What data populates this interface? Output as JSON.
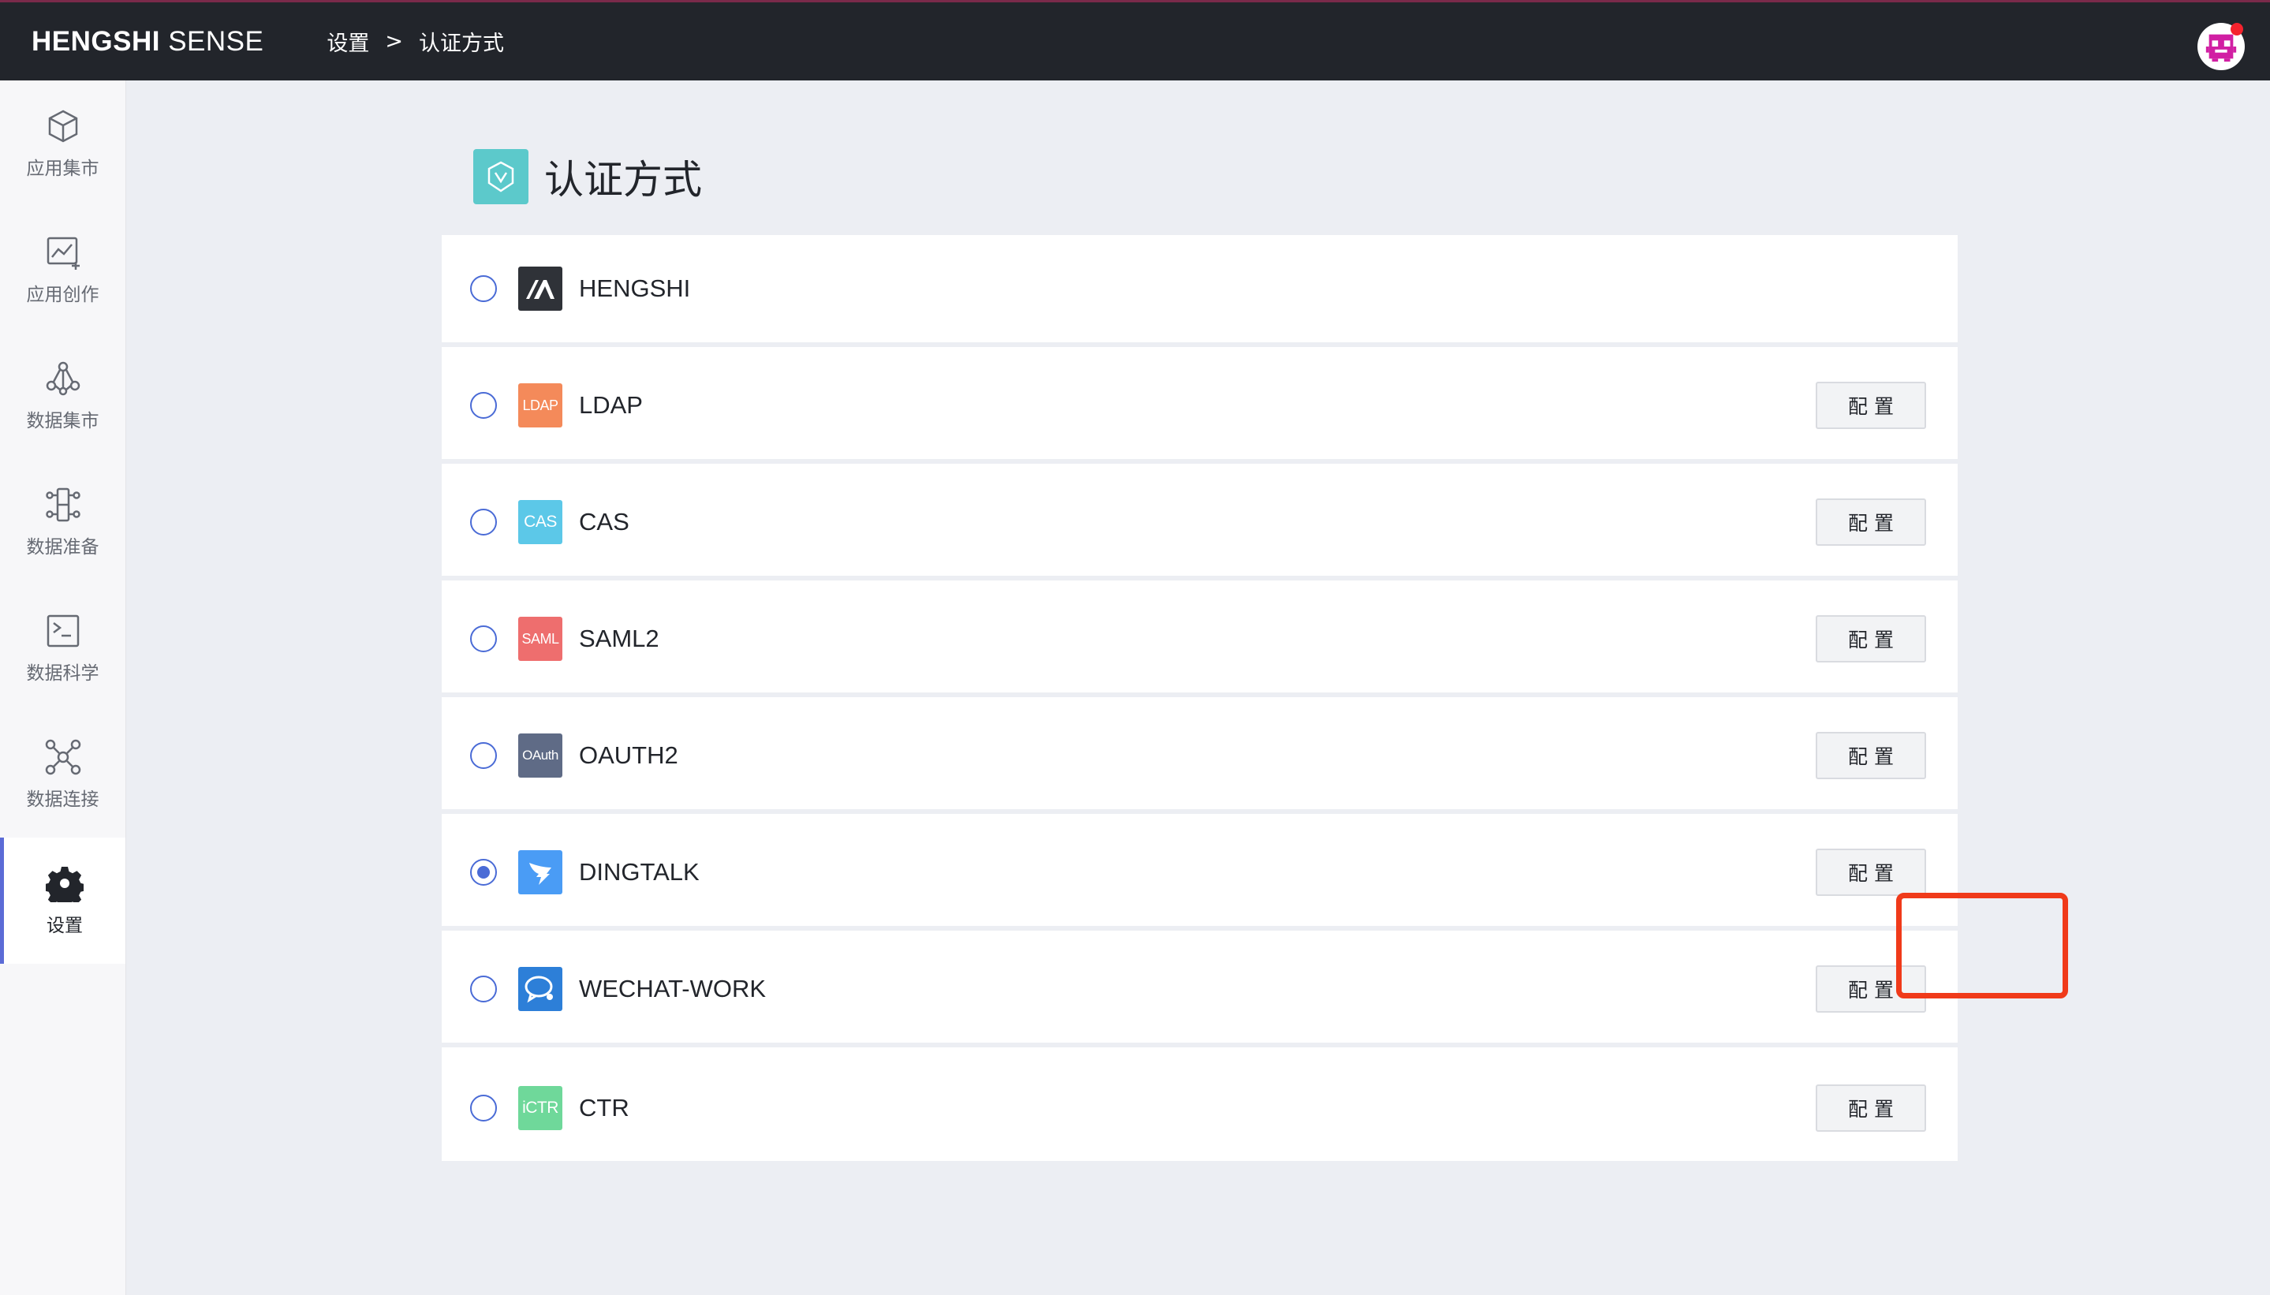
{
  "topbar": {
    "brand_bold": "HENGSHI",
    "brand_light": "SENSE",
    "breadcrumb": [
      "设置",
      ">",
      "认证方式"
    ]
  },
  "sidebar": {
    "items": [
      {
        "label": "应用集市",
        "icon": "cube-icon"
      },
      {
        "label": "应用创作",
        "icon": "chart-create-icon"
      },
      {
        "label": "数据集市",
        "icon": "data-market-icon"
      },
      {
        "label": "数据准备",
        "icon": "data-prep-icon"
      },
      {
        "label": "数据科学",
        "icon": "terminal-icon"
      },
      {
        "label": "数据连接",
        "icon": "network-icon"
      },
      {
        "label": "设置",
        "icon": "gear-icon",
        "active": true
      }
    ]
  },
  "page": {
    "title": "认证方式"
  },
  "auth_methods": [
    {
      "name": "HENGSHI",
      "logo_text": "",
      "logo_color": "#2f3238",
      "selected": false,
      "has_config": false
    },
    {
      "name": "LDAP",
      "logo_text": "LDAP",
      "logo_color": "#f48a5a",
      "selected": false,
      "has_config": true
    },
    {
      "name": "CAS",
      "logo_text": "CAS",
      "logo_color": "#5cc8e8",
      "selected": false,
      "has_config": true
    },
    {
      "name": "SAML2",
      "logo_text": "SAML",
      "logo_color": "#ee6e6e",
      "selected": false,
      "has_config": true
    },
    {
      "name": "OAUTH2",
      "logo_text": "OAuth",
      "logo_color": "#5f6b86",
      "selected": false,
      "has_config": true
    },
    {
      "name": "DINGTALK",
      "logo_text": "",
      "logo_color": "#4a9cf5",
      "selected": true,
      "has_config": true
    },
    {
      "name": "WECHAT-WORK",
      "logo_text": "",
      "logo_color": "#2d7fd8",
      "selected": false,
      "has_config": true
    },
    {
      "name": "CTR",
      "logo_text": "iCTR",
      "logo_color": "#6fd89a",
      "selected": false,
      "has_config": true
    }
  ],
  "config_label": "配置",
  "colors": {
    "accent": "#4a6bd6",
    "highlight": "#f03a1a",
    "topbar": "#22252b"
  }
}
